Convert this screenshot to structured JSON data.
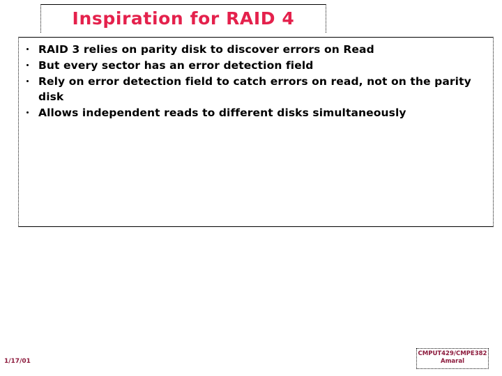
{
  "slide": {
    "title": "Inspiration for RAID 4",
    "title_color": "#E4214C",
    "body_text_color": "#000000",
    "background_color": "#FFFFFF",
    "bullets": [
      "RAID 3 relies on parity disk to discover errors on Read",
      "But every sector has an error detection field",
      "Rely on error detection field to catch errors on read, not on the parity disk",
      "Allows independent reads to different disks simultaneously"
    ],
    "footer": {
      "date": "1/17/01",
      "course": "CMPUT429/CMPE382",
      "author": "Amaral",
      "color": "#8C1A3C"
    }
  }
}
